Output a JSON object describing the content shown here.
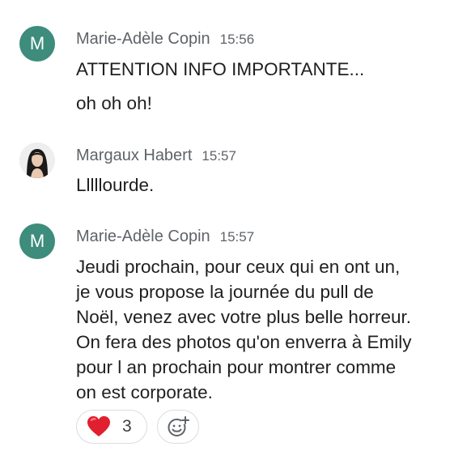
{
  "messages": [
    {
      "sender": "Marie-Adèle Copin",
      "avatar_letter": "M",
      "time": "15:56",
      "lines": [
        "ATTENTION INFO IMPORTANTE...",
        "oh oh oh!"
      ]
    },
    {
      "sender": "Margaux Habert",
      "avatar_icon": "user-photo",
      "time": "15:57",
      "lines": [
        "Lllllourde."
      ]
    },
    {
      "sender": "Marie-Adèle Copin",
      "avatar_letter": "M",
      "time": "15:57",
      "lines": [
        "Jeudi prochain, pour ceux qui en ont un,",
        "je vous propose la journée du pull de",
        "Noël, venez avec votre plus belle horreur.",
        "On fera des photos qu'on enverra à Emily",
        "pour l an prochain pour montrer comme",
        "on est corporate."
      ],
      "reactions": [
        {
          "emoji_icon": "red-heart",
          "count": "3"
        }
      ]
    }
  ],
  "colors": {
    "avatar_bg": "#3d8c7c",
    "meta_text": "#5f6368",
    "body_text": "#1f1f1f",
    "heart": "#e0202e",
    "chip_border": "#dadce0"
  }
}
